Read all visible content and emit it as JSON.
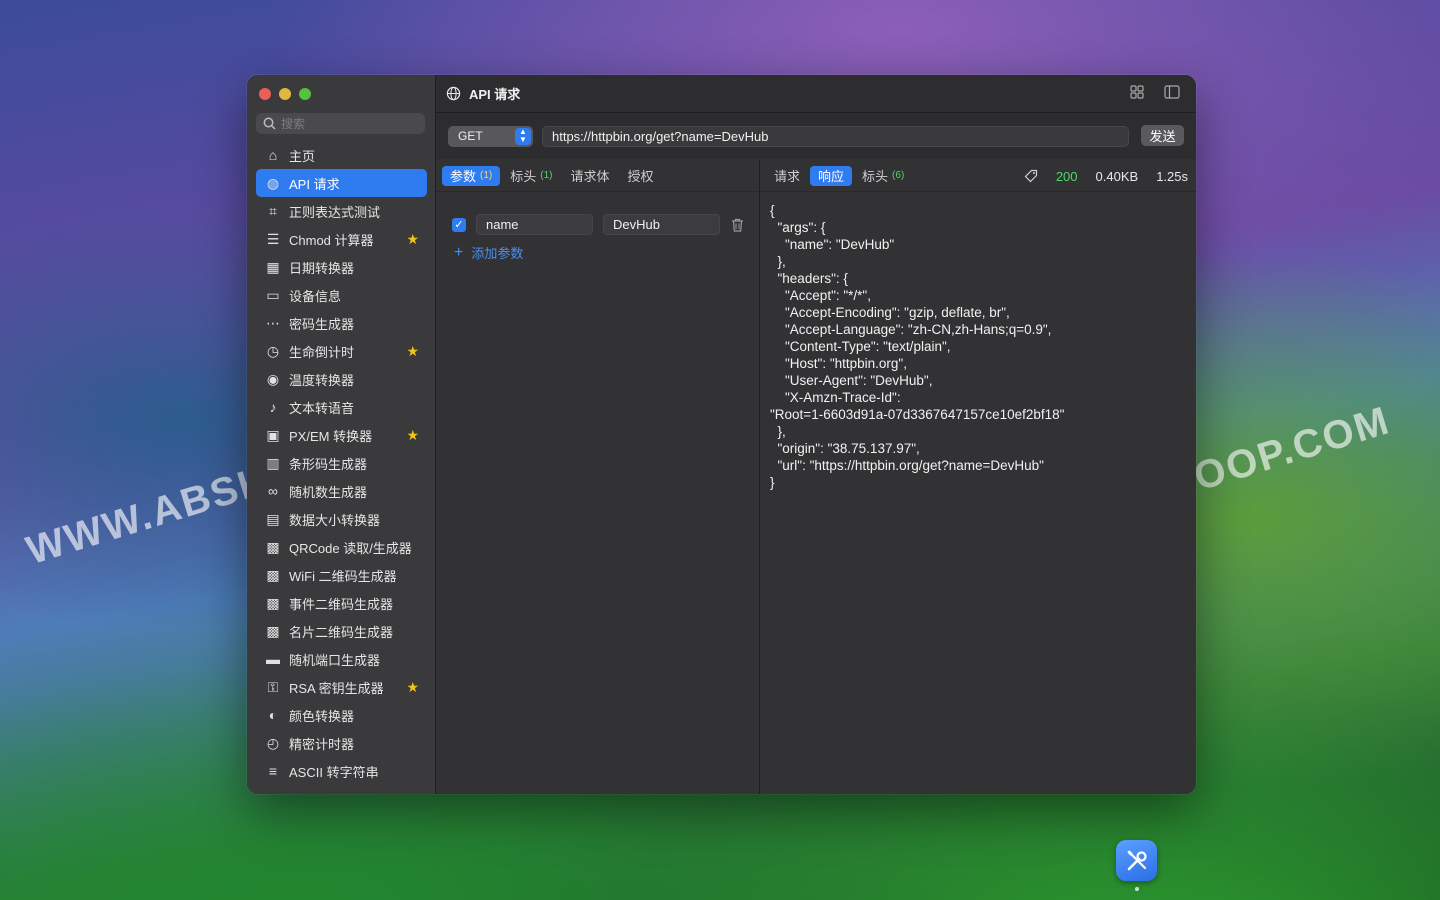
{
  "window": {
    "title": "API 请求"
  },
  "sidebar": {
    "search_placeholder": "搜索",
    "items": [
      {
        "label": "主页",
        "icon": "home-icon",
        "active": false,
        "starred": false
      },
      {
        "label": "API 请求",
        "icon": "globe-icon",
        "active": true,
        "starred": false
      },
      {
        "label": "正则表达式测试",
        "icon": "regex-icon",
        "active": false,
        "starred": false
      },
      {
        "label": "Chmod 计算器",
        "icon": "chmod-icon",
        "active": false,
        "starred": true
      },
      {
        "label": "日期转换器",
        "icon": "calendar-icon",
        "active": false,
        "starred": false
      },
      {
        "label": "设备信息",
        "icon": "monitor-icon",
        "active": false,
        "starred": false
      },
      {
        "label": "密码生成器",
        "icon": "password-icon",
        "active": false,
        "starred": false
      },
      {
        "label": "生命倒计时",
        "icon": "timer-icon",
        "active": false,
        "starred": true
      },
      {
        "label": "温度转换器",
        "icon": "temperature-icon",
        "active": false,
        "starred": false
      },
      {
        "label": "文本转语音",
        "icon": "speech-icon",
        "active": false,
        "starred": false
      },
      {
        "label": "PX/EM 转换器",
        "icon": "css-icon",
        "active": false,
        "starred": true
      },
      {
        "label": "条形码生成器",
        "icon": "barcode-icon",
        "active": false,
        "starred": false
      },
      {
        "label": "随机数生成器",
        "icon": "infinity-icon",
        "active": false,
        "starred": false
      },
      {
        "label": "数据大小转换器",
        "icon": "disk-icon",
        "active": false,
        "starred": false
      },
      {
        "label": "QRCode 读取/生成器",
        "icon": "qrcode-icon",
        "active": false,
        "starred": false
      },
      {
        "label": "WiFi 二维码生成器",
        "icon": "qrcode-icon",
        "active": false,
        "starred": false
      },
      {
        "label": "事件二维码生成器",
        "icon": "qrcode-icon",
        "active": false,
        "starred": false
      },
      {
        "label": "名片二维码生成器",
        "icon": "qrcode-icon",
        "active": false,
        "starred": false
      },
      {
        "label": "随机端口生成器",
        "icon": "router-icon",
        "active": false,
        "starred": false
      },
      {
        "label": "RSA 密钥生成器",
        "icon": "key-icon",
        "active": false,
        "starred": true
      },
      {
        "label": "颜色转换器",
        "icon": "palette-icon",
        "active": false,
        "starred": false
      },
      {
        "label": "精密计时器",
        "icon": "stopwatch-icon",
        "active": false,
        "starred": false
      },
      {
        "label": "ASCII 转字符串",
        "icon": "text-icon",
        "active": false,
        "starred": false
      }
    ]
  },
  "request": {
    "method": "GET",
    "url": "https://httpbin.org/get?name=DevHub",
    "send_label": "发送",
    "tabs": [
      {
        "label": "参数",
        "count": "(1)",
        "active": true
      },
      {
        "label": "标头",
        "count": "(1)",
        "active": false
      },
      {
        "label": "请求体",
        "count": "",
        "active": false
      },
      {
        "label": "授权",
        "count": "",
        "active": false
      }
    ],
    "params": [
      {
        "enabled": true,
        "key": "name",
        "value": "DevHub"
      }
    ],
    "add_param_label": "添加参数"
  },
  "response": {
    "tabs": [
      {
        "label": "请求",
        "count": "",
        "active": false
      },
      {
        "label": "响应",
        "count": "",
        "active": true
      },
      {
        "label": "标头",
        "count": "(6)",
        "active": false
      }
    ],
    "status": "200",
    "size": "0.40KB",
    "time": "1.25s",
    "body": "{\n  \"args\": {\n    \"name\": \"DevHub\"\n  },\n  \"headers\": {\n    \"Accept\": \"*/*\",\n    \"Accept-Encoding\": \"gzip, deflate, br\",\n    \"Accept-Language\": \"zh-CN,zh-Hans;q=0.9\",\n    \"Content-Type\": \"text/plain\",\n    \"Host\": \"httpbin.org\",\n    \"User-Agent\": \"DevHub\",\n    \"X-Amzn-Trace-Id\":\n\"Root=1-6603d91a-07d3367647157ce10ef2bf18\"\n  },\n  \"origin\": \"38.75.137.97\",\n  \"url\": \"https://httpbin.org/get?name=DevHub\"\n}"
  },
  "watermarks": [
    "WWW.ABSKOOP.COM",
    "WWW.ABSKOOP.COM"
  ],
  "colors": {
    "accent": "#2f7cf0",
    "status_ok": "#4cd964",
    "star": "#f0c419"
  }
}
